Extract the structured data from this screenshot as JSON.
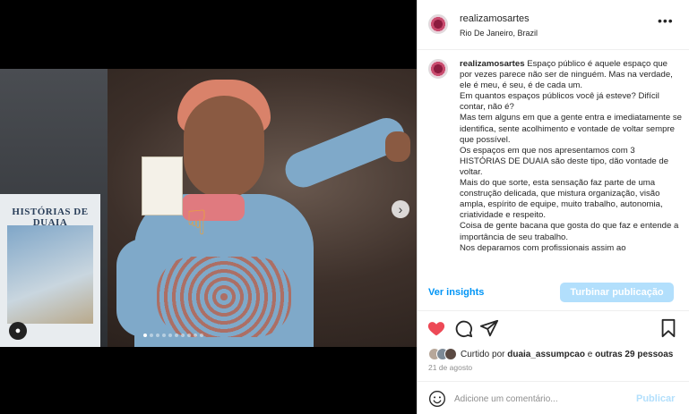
{
  "post": {
    "username": "realizamosartes",
    "location": "Rio De Janeiro, Brazil",
    "more_icon": "more-horizontal-icon",
    "media": {
      "poster_text": "HISTÓRIAS DE DUAIA",
      "slide_count": 10,
      "active_slide": 1,
      "next_icon": "chevron-right-icon",
      "tag_icon": "user-tag-icon"
    },
    "caption": {
      "username": "realizamosartes",
      "lines": [
        "Espaço público é aquele espaço que por vezes parece não ser de ninguém. Mas na verdade, ele é meu, é seu, é de cada um.",
        "Em quantos espaços públicos você já esteve? Difícil contar, não é?",
        "Mas tem alguns em que a gente entra e imediatamente se identifica, sente acolhimento e vontade de voltar sempre que possível.",
        "Os espaços em que nos apresentamos com 3 HISTÓRIAS DE DUAIA são deste tipo, dão vontade de voltar.",
        "Mais do que sorte, esta sensação faz parte de uma construção delicada, que mistura organização, visão ampla, espírito de equipe, muito trabalho, autonomia, criatividade e respeito.",
        "Coisa de gente bacana que gosta do que faz e entende a importância de seu trabalho.",
        "Nos deparamos com profissionais assim ao"
      ]
    },
    "insights_label": "Ver insights",
    "boost_label": "Turbinar publicação",
    "likes": {
      "prefix": "Curtido por",
      "first_liker": "duaia_assumpcao",
      "conjunction": "e",
      "others": "outras 29 pessoas"
    },
    "date": "21 de agosto",
    "comment": {
      "placeholder": "Adicione um comentário...",
      "post_label": "Publicar"
    },
    "colors": {
      "link": "#0095f6",
      "boost_bg": "#b2dffc",
      "like": "#ed4956"
    }
  }
}
